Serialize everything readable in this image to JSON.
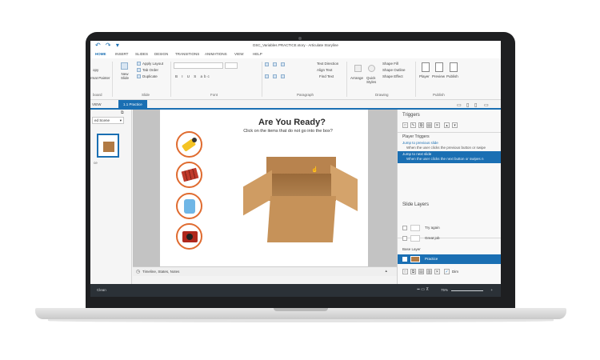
{
  "window": {
    "title": "DSC_Variables PRACTICE.story - Articulate Storyline",
    "qat": "↶ ↷ ▾"
  },
  "ribbon_tabs": [
    {
      "label": "HOME",
      "active": true
    },
    {
      "label": "INSERT"
    },
    {
      "label": "SLIDES"
    },
    {
      "label": "DESIGN"
    },
    {
      "label": "TRANSITIONS"
    },
    {
      "label": "ANIMATIONS"
    },
    {
      "label": "VIEW"
    },
    {
      "label": "HELP"
    }
  ],
  "ribbon": {
    "clipboard_paste": "opy",
    "clipboard_painter": "rmat Painter",
    "clipboard_group": "board",
    "new_slide": "New Slide",
    "apply_layout": "Apply Layout",
    "tab_order": "Tab Order",
    "duplicate": "Duplicate",
    "slide_group": "Slide",
    "font_group": "Font",
    "font_format": "B I U S abc",
    "text_direction": "Text Direction",
    "align_text": "Align Text",
    "find_text": "Find Text",
    "paragraph_group": "Paragraph",
    "arrange": "Arrange",
    "quick_styles": "Quick Styles",
    "shape_fill": "Shape Fill",
    "shape_outline": "Shape Outline",
    "shape_effect": "Shape Effect",
    "drawing_group": "Drawing",
    "player": "Player",
    "preview": "Preview",
    "publish": "Publish",
    "publish_group": "Publish"
  },
  "view_tabs": {
    "story_view": "VIEW",
    "slide_tab": "1.1 Practice"
  },
  "left_panel": {
    "scene_dropdown": "ed Scene",
    "thumb_label": "ce"
  },
  "slide": {
    "title": "Are You Ready?",
    "subtitle": "Click on the items that do not go into the box?"
  },
  "timeline": {
    "label": "Timeline, States, Notes"
  },
  "triggers": {
    "header": "Triggers",
    "player_triggers": "Player Triggers",
    "t1_link": "Jump to previous slide",
    "t1_desc": "When the user clicks the previous button or swipe",
    "t2_link": "Jump to next slide",
    "t2_desc": "When the user clicks the next button or swipes n"
  },
  "slide_layers": {
    "header": "Slide Layers",
    "layers": [
      {
        "name": "Try again"
      },
      {
        "name": "Great job"
      }
    ],
    "base_layer_label": "Base Layer",
    "base_layer_name": "Practice",
    "dim_label": "Dim"
  },
  "status": {
    "left": "Clean",
    "zoom": "75%"
  },
  "colors": {
    "accent": "#1a6fb3",
    "item_ring": "#e06b2f",
    "status_bar": "#2b3137"
  }
}
